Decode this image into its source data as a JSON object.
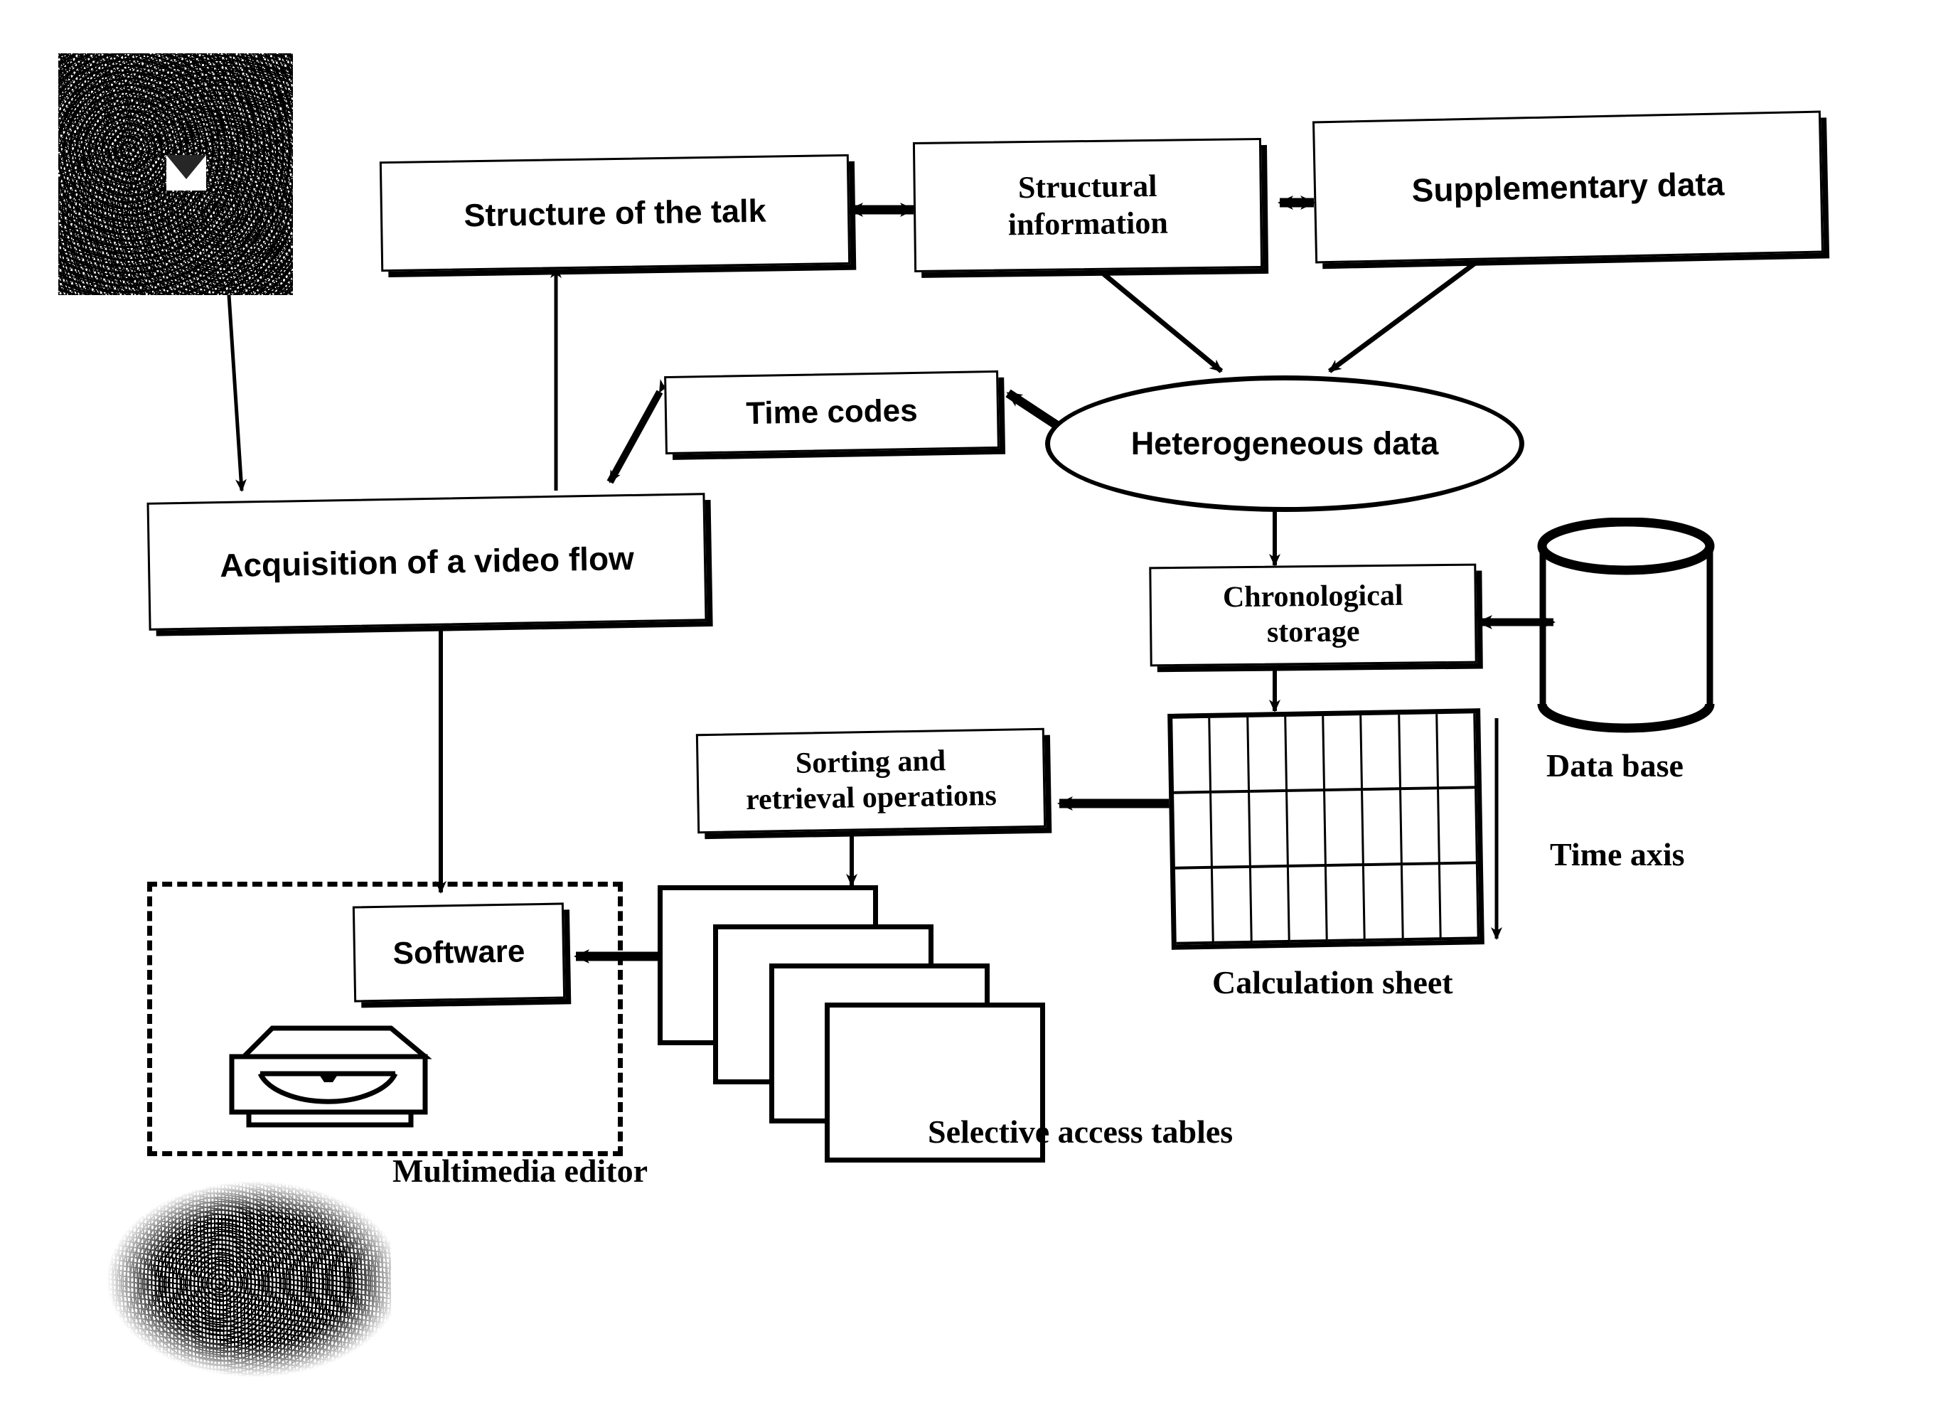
{
  "diagram": {
    "title_visible": false,
    "nodes": {
      "structure_of_talk": "Structure of the talk",
      "structural_information": "Structural\ninformation",
      "structural_information_l1": "Structural",
      "structural_information_l2": "information",
      "supplementary_data": "Supplementary data",
      "time_codes": "Time codes",
      "heterogeneous_data": "Heterogeneous data",
      "acquisition": "Acquisition of a video flow",
      "chronological_storage_l1": "Chronological",
      "chronological_storage_l2": "storage",
      "sorting_l1": "Sorting and",
      "sorting_l2": "retrieval operations",
      "software": "Software"
    },
    "captions": {
      "data_base": "Data base",
      "time_axis": "Time axis",
      "calculation_sheet": "Calculation sheet",
      "selective_access_tables": "Selective access tables",
      "multimedia_editor": "Multimedia editor"
    },
    "icons": {
      "video_frame": "dithered-video-frame-image",
      "computer": "dithered-computer-workstation-image",
      "database": "database-cylinder-icon",
      "multimedia_device": "multimedia-player-device-icon"
    },
    "grid": {
      "columns": 8,
      "rows": 3
    },
    "stack": {
      "count": 4
    },
    "colors": {
      "ink": "#000000",
      "paper": "#ffffff"
    },
    "edges": [
      {
        "from": "structure_of_talk",
        "to": "structural_information",
        "type": "double"
      },
      {
        "from": "structural_information",
        "to": "supplementary_data",
        "type": "double"
      },
      {
        "from": "structural_information",
        "to": "heterogeneous_data",
        "type": "single"
      },
      {
        "from": "supplementary_data",
        "to": "heterogeneous_data",
        "type": "single"
      },
      {
        "from": "heterogeneous_data",
        "to": "time_codes",
        "type": "single"
      },
      {
        "from": "time_codes",
        "to": "acquisition",
        "type": "double"
      },
      {
        "from": "video_frame",
        "to": "acquisition",
        "type": "single"
      },
      {
        "from": "acquisition",
        "to": "structure_of_talk",
        "type": "single"
      },
      {
        "from": "heterogeneous_data",
        "to": "chronological_storage",
        "type": "single"
      },
      {
        "from": "chronological_storage",
        "to": "data_base",
        "type": "double"
      },
      {
        "from": "chronological_storage",
        "to": "calculation_sheet",
        "type": "single"
      },
      {
        "from": "calculation_sheet",
        "to": "sorting",
        "type": "single"
      },
      {
        "from": "sorting",
        "to": "selective_access_tables",
        "type": "single"
      },
      {
        "from": "selective_access_tables",
        "to": "software",
        "type": "single"
      },
      {
        "from": "acquisition",
        "to": "software",
        "type": "single"
      }
    ]
  }
}
